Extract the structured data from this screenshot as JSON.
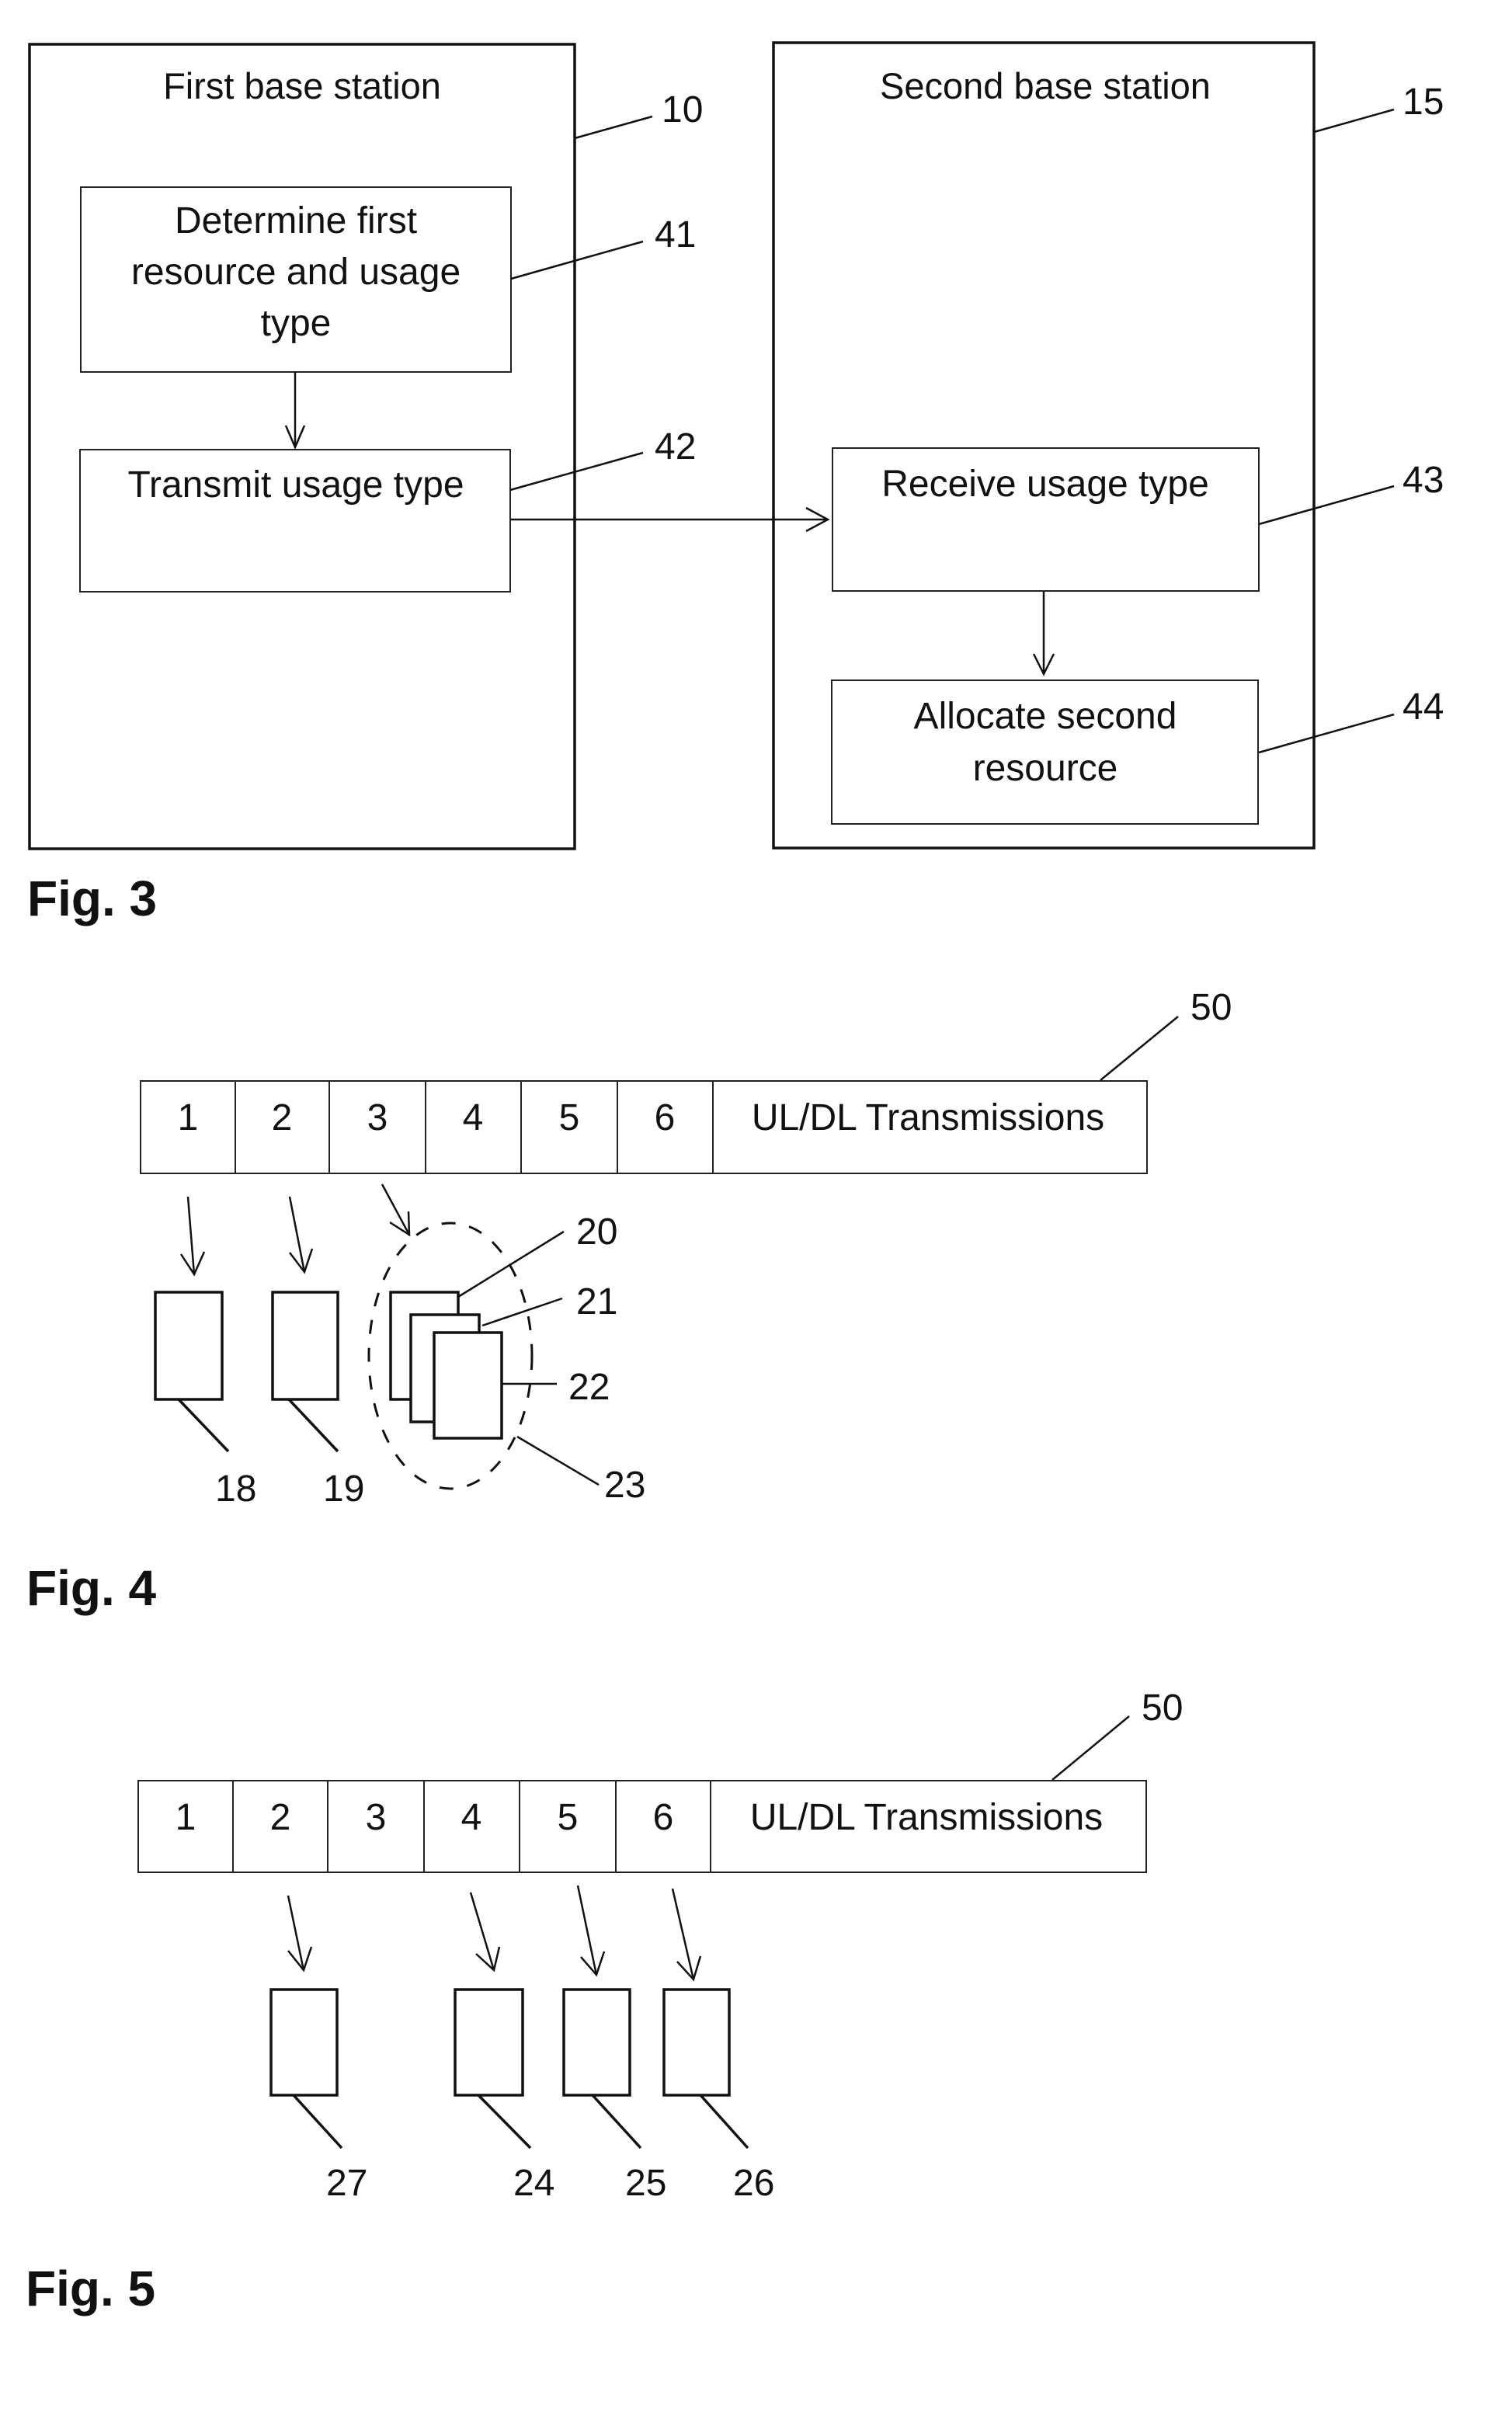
{
  "fig3": {
    "caption": "Fig. 3",
    "first_station": {
      "title": "First base station",
      "ref": "10",
      "steps": [
        {
          "lines": [
            "Determine first",
            "resource and usage",
            "type"
          ],
          "ref": "41"
        },
        {
          "lines": [
            "Transmit usage type"
          ],
          "ref": "42"
        }
      ]
    },
    "second_station": {
      "title": "Second base station",
      "ref": "15",
      "steps": [
        {
          "lines": [
            "Receive usage type"
          ],
          "ref": "43"
        },
        {
          "lines": [
            "Allocate second",
            "resource"
          ],
          "ref": "44"
        }
      ]
    }
  },
  "fig4": {
    "caption": "Fig. 4",
    "frame_ref": "50",
    "cells": [
      "1",
      "2",
      "3",
      "4",
      "5",
      "6"
    ],
    "tail_label": "UL/DL Transmissions",
    "resource_refs": [
      "18",
      "19",
      "20",
      "21",
      "22"
    ],
    "group_ref": "23"
  },
  "fig5": {
    "caption": "Fig. 5",
    "frame_ref": "50",
    "cells": [
      "1",
      "2",
      "3",
      "4",
      "5",
      "6"
    ],
    "tail_label": "UL/DL Transmissions",
    "resource_refs": [
      "27",
      "24",
      "25",
      "26"
    ]
  }
}
